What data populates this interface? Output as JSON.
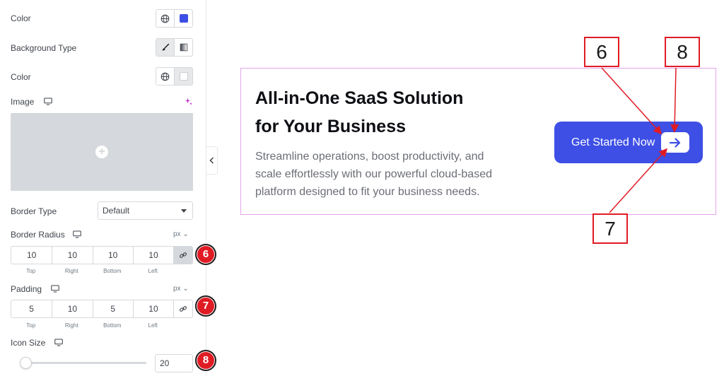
{
  "panel": {
    "color_label": "Color",
    "bg_type_label": "Background Type",
    "color2_label": "Color",
    "image_label": "Image",
    "border_type_label": "Border Type",
    "border_type_value": "Default",
    "border_radius_label": "Border Radius",
    "border_radius_unit": "px",
    "border_radius": {
      "top": "10",
      "right": "10",
      "bottom": "10",
      "left": "10"
    },
    "padding_label": "Padding",
    "padding_unit": "px",
    "padding": {
      "top": "5",
      "right": "10",
      "bottom": "5",
      "left": "10"
    },
    "dim_labels": {
      "top": "Top",
      "right": "Right",
      "bottom": "Bottom",
      "left": "Left"
    },
    "icon_size_label": "Icon Size",
    "icon_size_value": "20",
    "icon_size_fraction": 0.05,
    "colors": {
      "swatch_blue": "#3d4fe5",
      "swatch_white": "#ffffff"
    }
  },
  "badges": {
    "b6": "6",
    "b7": "7",
    "b8": "8"
  },
  "preview": {
    "headline_line1": "All-in-One SaaS Solution",
    "headline_line2": "for Your Business",
    "desc_line1": "Streamline operations, boost productivity, and",
    "desc_line2": "scale effortlessly with our powerful cloud-based",
    "desc_line3": "platform designed to fit your business needs.",
    "cta_label": "Get Started Now",
    "cta_color": "#3d4fe5"
  },
  "annotations": {
    "a6": "6",
    "a7": "7",
    "a8": "8",
    "color": "#e01b24"
  }
}
